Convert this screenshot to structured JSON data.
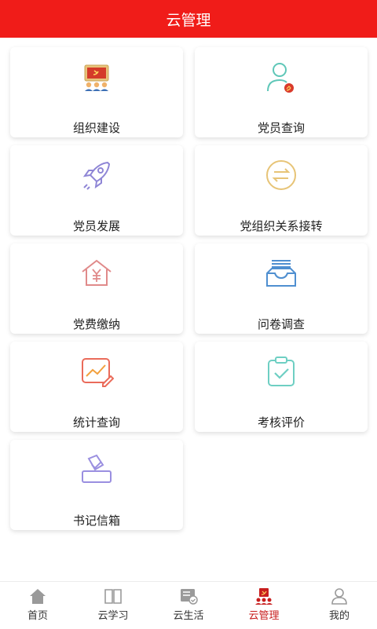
{
  "header": {
    "title": "云管理"
  },
  "cards": [
    {
      "label": "组织建设",
      "icon": "party-meeting-icon"
    },
    {
      "label": "党员查询",
      "icon": "member-search-icon"
    },
    {
      "label": "党员发展",
      "icon": "rocket-icon"
    },
    {
      "label": "党组织关系接转",
      "icon": "transfer-arrows-icon"
    },
    {
      "label": "党费缴纳",
      "icon": "yuan-house-icon"
    },
    {
      "label": "问卷调查",
      "icon": "inbox-survey-icon"
    },
    {
      "label": "统计查询",
      "icon": "chart-edit-icon"
    },
    {
      "label": "考核评价",
      "icon": "clipboard-check-icon"
    },
    {
      "label": "书记信箱",
      "icon": "ballot-box-icon"
    }
  ],
  "tabbar": {
    "items": [
      {
        "label": "首页",
        "icon": "home-icon"
      },
      {
        "label": "云学习",
        "icon": "book-icon"
      },
      {
        "label": "云生活",
        "icon": "life-card-icon"
      },
      {
        "label": "云管理",
        "icon": "party-emblem-icon",
        "active": true
      },
      {
        "label": "我的",
        "icon": "user-icon"
      }
    ]
  },
  "colors": {
    "header_bg": "#f01c19",
    "active_tab": "#c81e1e"
  }
}
